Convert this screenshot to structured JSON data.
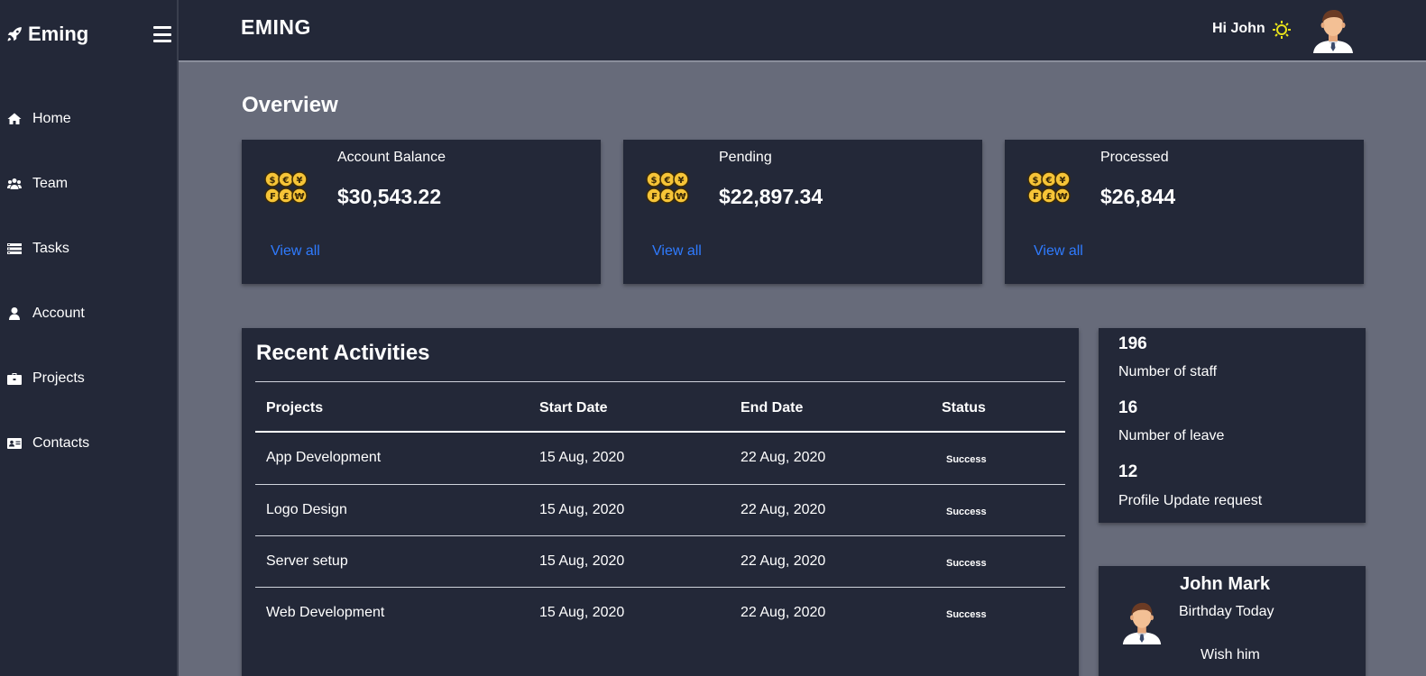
{
  "colors": {
    "sidebar_bg": "#232838",
    "page_bg": "#676b7a",
    "link": "#2f7bff",
    "accent_sun": "#e8e21a",
    "coin": "#f6c437"
  },
  "sidebar": {
    "brand": "Eming",
    "brand_icon": "rocket-icon",
    "menu_icon": "hamburger-icon",
    "items": [
      {
        "label": "Home",
        "icon": "home-icon"
      },
      {
        "label": "Team",
        "icon": "users-icon"
      },
      {
        "label": "Tasks",
        "icon": "list-icon"
      },
      {
        "label": "Account",
        "icon": "user-icon"
      },
      {
        "label": "Projects",
        "icon": "briefcase-icon"
      },
      {
        "label": "Contacts",
        "icon": "id-card-icon"
      }
    ]
  },
  "header": {
    "title": "EMING",
    "greeting": "Hi John",
    "theme_icon": "sun-icon",
    "avatar_icon": "user-avatar-icon"
  },
  "overview": {
    "title": "Overview",
    "cards": [
      {
        "label": "Account Balance",
        "value": "$30,543.22",
        "link": "View all",
        "icon": "currency-coins-icon"
      },
      {
        "label": "Pending",
        "value": "$22,897.34",
        "link": "View all",
        "icon": "currency-coins-icon"
      },
      {
        "label": "Processed",
        "value": "$26,844",
        "link": "View all",
        "icon": "currency-coins-icon"
      }
    ]
  },
  "activities": {
    "title": "Recent Activities",
    "columns": [
      "Projects",
      "Start Date",
      "End Date",
      "Status"
    ],
    "rows": [
      {
        "project": "App Development",
        "start": "15 Aug, 2020",
        "end": "22 Aug, 2020",
        "status": "Success"
      },
      {
        "project": "Logo Design",
        "start": "15 Aug, 2020",
        "end": "22 Aug, 2020",
        "status": "Success"
      },
      {
        "project": "Server setup",
        "start": "15 Aug, 2020",
        "end": "22 Aug, 2020",
        "status": "Success"
      },
      {
        "project": "Web Development",
        "start": "15 Aug, 2020",
        "end": "22 Aug, 2020",
        "status": "Success"
      }
    ]
  },
  "stats": [
    {
      "value": "196",
      "label": "Number of staff"
    },
    {
      "value": "16",
      "label": "Number of leave"
    },
    {
      "value": "12",
      "label": "Profile Update request"
    }
  ],
  "birthday": {
    "name": "John Mark",
    "subtitle": "Birthday Today",
    "action": "Wish him"
  }
}
